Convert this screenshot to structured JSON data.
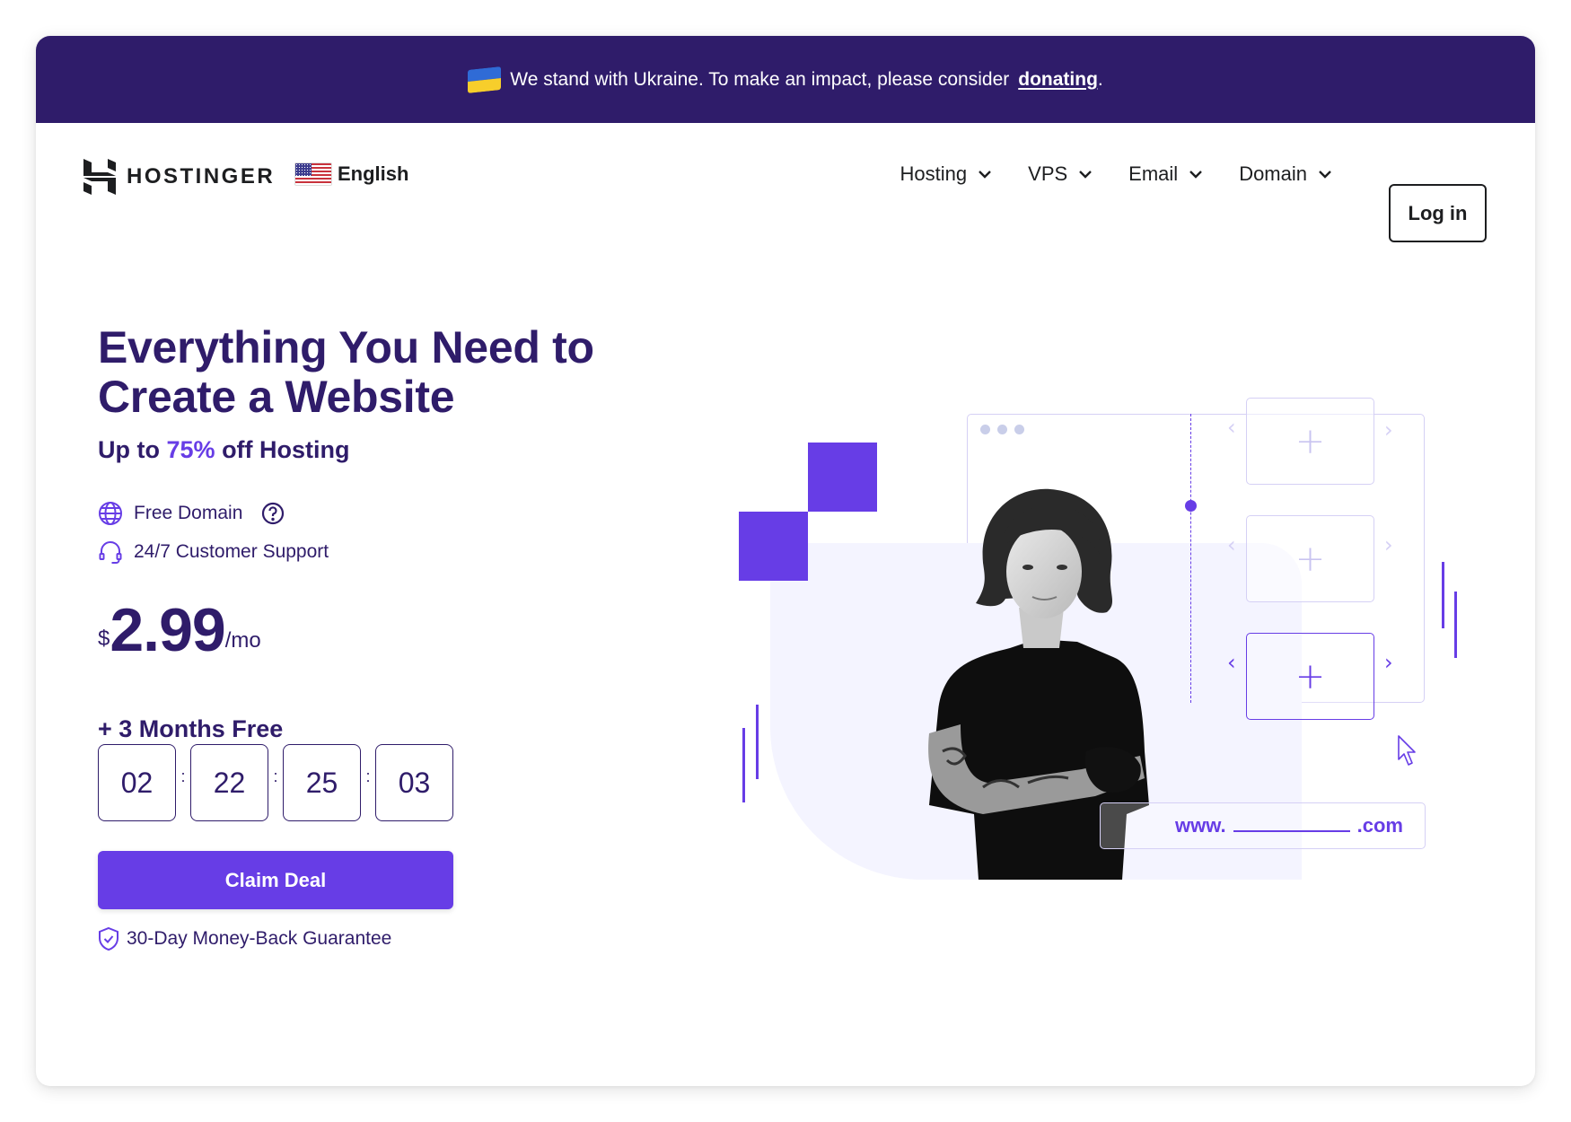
{
  "banner": {
    "message": "We stand with Ukraine. To make an impact, please consider",
    "link_label": "donating",
    "suffix": ".",
    "flag_icon": "ukraine-flag-icon"
  },
  "header": {
    "logo_text": "HOSTINGER",
    "language": "English",
    "nav": [
      {
        "label": "Hosting"
      },
      {
        "label": "VPS"
      },
      {
        "label": "Email"
      },
      {
        "label": "Domain"
      }
    ],
    "login_label": "Log in"
  },
  "hero": {
    "title_line1": "Everything You Need to",
    "title_line2": "Create a Website",
    "sub_prefix": "Up to",
    "sub_accent": "75%",
    "sub_suffix": "off Hosting",
    "features": [
      {
        "label": "Free Domain",
        "icon": "globe-icon"
      },
      {
        "label": "24/7 Customer Support",
        "icon": "headset-icon"
      }
    ],
    "price": {
      "currency": "$",
      "amount": "2.99",
      "period": "/mo"
    },
    "bonus": "+ 3 Months Free",
    "timer": [
      "02",
      "22",
      "25",
      "03"
    ],
    "timer_separator": ":",
    "cta_label": "Claim Deal",
    "guarantee": "30-Day Money-Back Guarantee"
  },
  "illustration": {
    "url_prefix": "www.",
    "url_suffix": ".com",
    "plus": "+",
    "arrow_left": "‹",
    "arrow_right": "›"
  },
  "colors": {
    "banner_bg": "#2F1C6A",
    "primary": "#673DE6",
    "text_dark": "#2F1C6A"
  }
}
